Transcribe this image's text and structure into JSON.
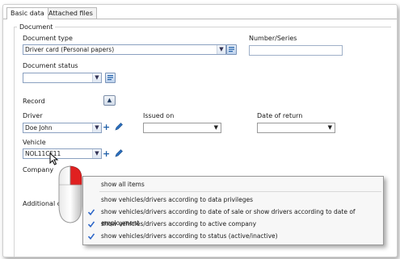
{
  "tabs": [
    {
      "label": "Basic data",
      "active": true
    },
    {
      "label": "Attached files",
      "active": false
    }
  ],
  "group_title": "Document",
  "labels": {
    "document_type": "Document type",
    "number_series": "Number/Series",
    "document_status": "Document status",
    "record": "Record",
    "driver": "Driver",
    "issued_on": "Issued on",
    "date_of_return": "Date of return",
    "vehicle": "Vehicle",
    "company": "Company",
    "additional": "Additional d"
  },
  "fields": {
    "document_type_value": "Driver card (Personal papers)",
    "driver_value": "Doe John",
    "vehicle_value": "NOL11CF11"
  },
  "context_menu": {
    "items": [
      {
        "label": "show all items",
        "checked": false
      },
      {
        "label": "show vehicles/drivers according to data privileges",
        "checked": false
      },
      {
        "label": "show vehicles/drivers according to date of sale or show drivers according to date of employment",
        "checked": true
      },
      {
        "label": "show vehicles/drivers according to active company",
        "checked": true
      },
      {
        "label": "show vehicles/drivers according to status (active/inactive)",
        "checked": true
      }
    ]
  },
  "icons": {
    "add": "plus-icon",
    "edit": "pencil-icon",
    "lookup": "list-lookup-icon",
    "collapse": "chevron-up-icon",
    "dropdown": "chevron-down-icon",
    "mouse": "mouse-icon"
  },
  "colors": {
    "accent_blue": "#1f5fa8",
    "check_blue": "#2a64c8",
    "mouse_red": "#e02020"
  }
}
